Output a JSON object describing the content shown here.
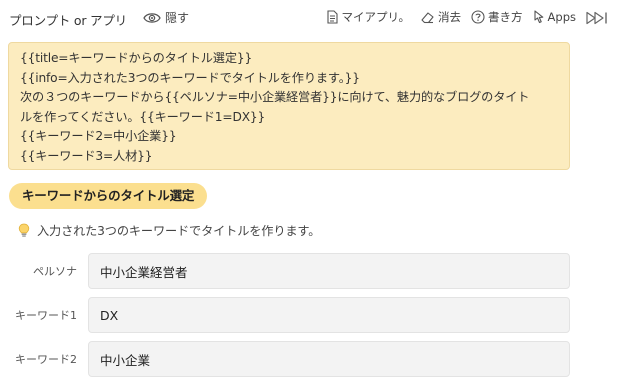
{
  "toolbar": {
    "title": "プロンプト or アプリ",
    "hide_label": "隠す",
    "my_apps_label": "マイアプリ。",
    "clear_label": "消去",
    "how_to_label": "書き方",
    "apps_label": "Apps"
  },
  "prompt": {
    "lines": [
      "{{title=キーワードからのタイトル選定}}",
      "{{info=入力された3つのキーワードでタイトルを作ります。}}",
      "次の３つのキーワードから{{ペルソナ=中小企業経営者}}に向けて、魅力的なブログのタイト",
      "ルを作ってください。{{キーワード1=DX}}",
      "{{キーワード2=中小企業}}",
      "{{キーワード3=人材}}"
    ]
  },
  "app": {
    "title": "キーワードからのタイトル選定",
    "info": "入力された3つのキーワードでタイトルを作ります。",
    "fields": [
      {
        "label": "ペルソナ",
        "value": "中小企業経営者"
      },
      {
        "label": "キーワード1",
        "value": "DX"
      },
      {
        "label": "キーワード2",
        "value": "中小企業"
      }
    ]
  },
  "icons": {
    "hide": "eye-icon",
    "my_apps": "document-icon",
    "clear": "eraser-icon",
    "how_to": "question-circle-icon",
    "apps": "cursor-icon",
    "panel_toggle": "fast-forward-icon",
    "info": "lightbulb-icon"
  },
  "colors": {
    "prompt_background": "#fcecbf",
    "title_pill": "#fbdf8f",
    "input_background": "#f3f3f3"
  }
}
